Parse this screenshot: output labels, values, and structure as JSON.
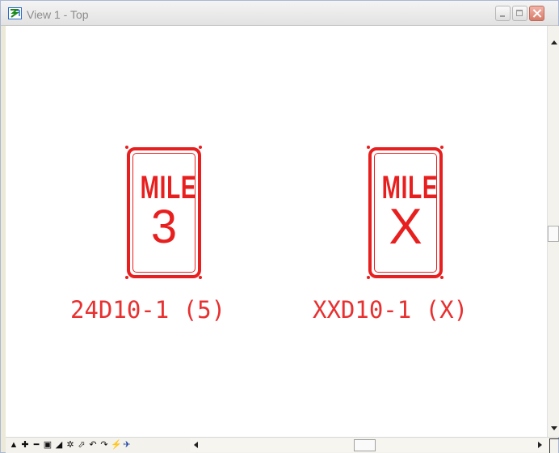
{
  "window": {
    "title": "View 1 - Top"
  },
  "signs": [
    {
      "word": "MILE",
      "number": "3",
      "code": "24D10-1 (5)"
    },
    {
      "word": "MILE",
      "number": "X",
      "code": "XXD10-1 (X)"
    }
  ],
  "colors": {
    "sign_red": "#e81f1f",
    "caption_red": "#e83030",
    "titlebar": "#e8e8e8",
    "close_button": "#d87a68"
  },
  "icons": [
    "app-icon",
    "minimize-icon",
    "maximize-icon",
    "close-icon",
    "scroll-up-icon",
    "scroll-down-icon",
    "scroll-left-icon",
    "scroll-right-icon"
  ],
  "view_tools": [
    "fit-view-icon",
    "zoom-in-icon",
    "zoom-out-icon",
    "window-area-icon",
    "update-icon",
    "rotate-view-icon",
    "pan-view-icon",
    "undo-view-icon",
    "redo-view-icon",
    "view-attributes-icon",
    "copy-view-icon"
  ]
}
